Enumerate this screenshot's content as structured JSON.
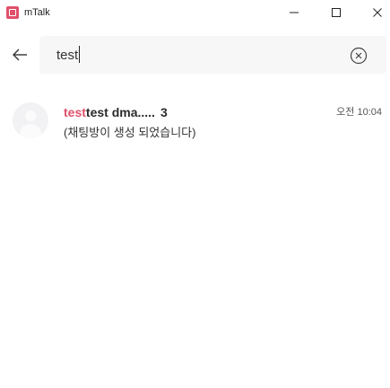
{
  "window": {
    "title": "mTalk",
    "logo_color": "#e0506a",
    "controls": {
      "minimize_icon": "minimize-icon",
      "maximize_icon": "maximize-icon",
      "close_icon": "close-icon"
    }
  },
  "search": {
    "back_icon": "arrow-left-icon",
    "value": "test",
    "placeholder": "",
    "clear_icon": "circle-x-icon"
  },
  "results": [
    {
      "name_highlight": "test",
      "name_rest": "test dma.....",
      "member_count": "3",
      "time": "오전 10:04",
      "preview": "(채팅방이 생성 되었습니다)",
      "avatar_icon": "default-avatar-icon"
    }
  ],
  "colors": {
    "accent": "#e0506a",
    "search_bg": "#f7f7f8",
    "avatar_bg": "#f2f2f4"
  }
}
